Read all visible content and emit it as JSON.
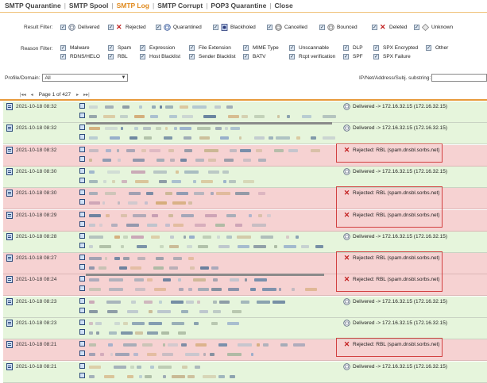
{
  "nav": {
    "tabs": [
      {
        "label": "SMTP Quarantine",
        "active": false
      },
      {
        "label": "SMTP Spool",
        "active": false
      },
      {
        "label": "SMTP Log",
        "active": true
      },
      {
        "label": "SMTP Corrupt",
        "active": false
      },
      {
        "label": "POP3 Quarantine",
        "active": false
      },
      {
        "label": "Close",
        "active": false
      }
    ]
  },
  "result_filter": {
    "label": "Result Filter:",
    "items": [
      {
        "label": "Delivered",
        "checked": true,
        "icon": "delivered-envelope-icon"
      },
      {
        "label": "Rejected",
        "checked": true,
        "icon": "rejected-x-icon"
      },
      {
        "label": "Quarantined",
        "checked": true,
        "icon": "quarantined-icon"
      },
      {
        "label": "Blackholed",
        "checked": true,
        "icon": "blackholed-icon"
      },
      {
        "label": "Cancelled",
        "checked": true,
        "icon": "cancelled-icon"
      },
      {
        "label": "Bounced",
        "checked": true,
        "icon": "bounced-icon"
      },
      {
        "label": "Deleted",
        "checked": true,
        "icon": "deleted-x-icon"
      },
      {
        "label": "Unknown",
        "checked": true,
        "icon": "unknown-icon"
      }
    ]
  },
  "reason_filter": {
    "label": "Reason Filter:",
    "items": [
      {
        "label": "Malware",
        "checked": true
      },
      {
        "label": "Spam",
        "checked": true
      },
      {
        "label": "Expression",
        "checked": true
      },
      {
        "label": "File Extension",
        "checked": true
      },
      {
        "label": "MIME Type",
        "checked": true
      },
      {
        "label": "Unscannable",
        "checked": true
      },
      {
        "label": "DLP",
        "checked": true
      },
      {
        "label": "SPX Encrypted",
        "checked": true
      },
      {
        "label": "Other",
        "checked": true
      },
      {
        "label": "RDNS/HELO",
        "checked": true
      },
      {
        "label": "RBL",
        "checked": true
      },
      {
        "label": "Host Blacklist",
        "checked": true
      },
      {
        "label": "Sender Blacklist",
        "checked": true
      },
      {
        "label": "BATV",
        "checked": true
      },
      {
        "label": "Rcpt verification",
        "checked": true
      },
      {
        "label": "SPF",
        "checked": true
      },
      {
        "label": "SPX Failure",
        "checked": true
      }
    ]
  },
  "profile": {
    "label": "Profile/Domain:",
    "value": "All"
  },
  "search": {
    "label": "IP/Net/Address/Subj. substring:",
    "value": ""
  },
  "pager": {
    "first": "|◂◂",
    "prev": "◂",
    "text": "Page 1 of 427",
    "next": "▸",
    "last": "▸▸|"
  },
  "rows": [
    {
      "date": "2021-10-18 08:32",
      "result": "delivered",
      "status": "Delivered -> 172.16.32.15 (172.16.32.15)",
      "highlighted": false
    },
    {
      "date": "2021-10-18 08:32",
      "result": "delivered",
      "status": "Delivered -> 172.16.32.15 (172.16.32.15)",
      "highlighted": false
    },
    {
      "date": "2021-10-18 08:32",
      "result": "rejected",
      "status": "Rejected: RBL (spam.dnsbl.sorbs.net)",
      "highlighted": true
    },
    {
      "date": "2021-10-18 08:30",
      "result": "delivered",
      "status": "Delivered -> 172.16.32.15 (172.16.32.15)",
      "highlighted": false
    },
    {
      "date": "2021-10-18 08:30",
      "result": "rejected",
      "status": "Rejected: RBL (spam.dnsbl.sorbs.net)",
      "highlighted": true
    },
    {
      "date": "2021-10-18 08:29",
      "result": "rejected",
      "status": "Rejected: RBL (spam.dnsbl.sorbs.net)",
      "highlighted": true
    },
    {
      "date": "2021-10-18 08:28",
      "result": "delivered",
      "status": "Delivered -> 172.16.32.15 (172.16.32.15)",
      "highlighted": false
    },
    {
      "date": "2021-10-18 08:27",
      "result": "rejected",
      "status": "Rejected: RBL (spam.dnsbl.sorbs.net)",
      "highlighted": true
    },
    {
      "date": "2021-10-18 08:24",
      "result": "rejected",
      "status": "Rejected: RBL (spam.dnsbl.sorbs.net)",
      "highlighted": true
    },
    {
      "date": "2021-10-18 08:23",
      "result": "delivered",
      "status": "Delivered -> 172.16.32.15 (172.16.32.15)",
      "highlighted": false
    },
    {
      "date": "2021-10-18 08:23",
      "result": "delivered",
      "status": "Delivered -> 172.16.32.15 (172.16.32.15)",
      "highlighted": false
    },
    {
      "date": "2021-10-18 08:21",
      "result": "rejected",
      "status": "Rejected: RBL (spam.dnsbl.sorbs.net)",
      "highlighted": true
    },
    {
      "date": "2021-10-18 08:21",
      "result": "delivered",
      "status": "Delivered -> 172.16.32.15 (172.16.32.15)",
      "highlighted": false
    }
  ],
  "colors": {
    "accent": "#e08a1e",
    "delivered_row": "#e6f5dc",
    "rejected_row": "#f6d2d2",
    "highlight_box": "#d24040"
  }
}
